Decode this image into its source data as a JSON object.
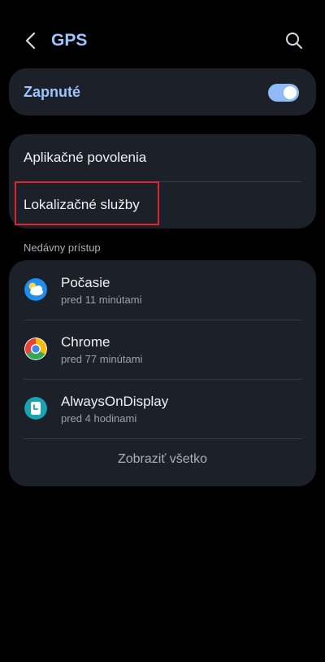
{
  "header": {
    "title": "GPS",
    "back_icon": "chevron-left-icon",
    "search_icon": "search-icon"
  },
  "toggle": {
    "label": "Zapnuté",
    "state": "on",
    "accent_color": "#8fbaf5"
  },
  "menu": {
    "items": [
      {
        "label": "Aplikačné povolenia"
      },
      {
        "label": "Lokalizačné služby",
        "highlighted": true
      }
    ]
  },
  "recent": {
    "section_title": "Nedávny prístup",
    "apps": [
      {
        "name": "Počasie",
        "time": "pred 11 minútami",
        "icon": "weather-icon"
      },
      {
        "name": "Chrome",
        "time": "pred 77 minútami",
        "icon": "chrome-icon"
      },
      {
        "name": "AlwaysOnDisplay",
        "time": "pred 4 hodinami",
        "icon": "clock-icon"
      }
    ],
    "show_all_label": "Zobraziť všetko"
  },
  "colors": {
    "background": "#000000",
    "card": "#1c2129",
    "title_accent": "#9cc4ff",
    "highlight_border": "#e0262a"
  }
}
